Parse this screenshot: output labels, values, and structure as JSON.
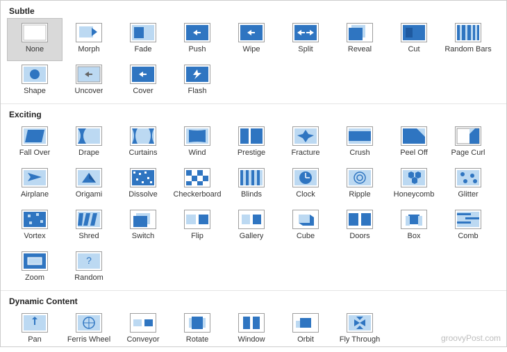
{
  "watermark": "groovyPost.com",
  "sections": [
    {
      "title": "Subtle",
      "items": [
        {
          "label": "None",
          "selected": true
        },
        {
          "label": "Morph"
        },
        {
          "label": "Fade"
        },
        {
          "label": "Push"
        },
        {
          "label": "Wipe"
        },
        {
          "label": "Split"
        },
        {
          "label": "Reveal"
        },
        {
          "label": "Cut"
        },
        {
          "label": "Random Bars"
        },
        {
          "label": "Shape"
        },
        {
          "label": "Uncover"
        },
        {
          "label": "Cover"
        },
        {
          "label": "Flash"
        }
      ]
    },
    {
      "title": "Exciting",
      "items": [
        {
          "label": "Fall Over"
        },
        {
          "label": "Drape"
        },
        {
          "label": "Curtains"
        },
        {
          "label": "Wind"
        },
        {
          "label": "Prestige"
        },
        {
          "label": "Fracture"
        },
        {
          "label": "Crush"
        },
        {
          "label": "Peel Off"
        },
        {
          "label": "Page Curl"
        },
        {
          "label": "Airplane"
        },
        {
          "label": "Origami"
        },
        {
          "label": "Dissolve"
        },
        {
          "label": "Checkerboard"
        },
        {
          "label": "Blinds"
        },
        {
          "label": "Clock"
        },
        {
          "label": "Ripple"
        },
        {
          "label": "Honeycomb"
        },
        {
          "label": "Glitter"
        },
        {
          "label": "Vortex"
        },
        {
          "label": "Shred"
        },
        {
          "label": "Switch"
        },
        {
          "label": "Flip"
        },
        {
          "label": "Gallery"
        },
        {
          "label": "Cube"
        },
        {
          "label": "Doors"
        },
        {
          "label": "Box"
        },
        {
          "label": "Comb"
        },
        {
          "label": "Zoom"
        },
        {
          "label": "Random"
        }
      ]
    },
    {
      "title": "Dynamic Content",
      "items": [
        {
          "label": "Pan"
        },
        {
          "label": "Ferris Wheel"
        },
        {
          "label": "Conveyor"
        },
        {
          "label": "Rotate"
        },
        {
          "label": "Window"
        },
        {
          "label": "Orbit"
        },
        {
          "label": "Fly Through"
        }
      ]
    }
  ]
}
